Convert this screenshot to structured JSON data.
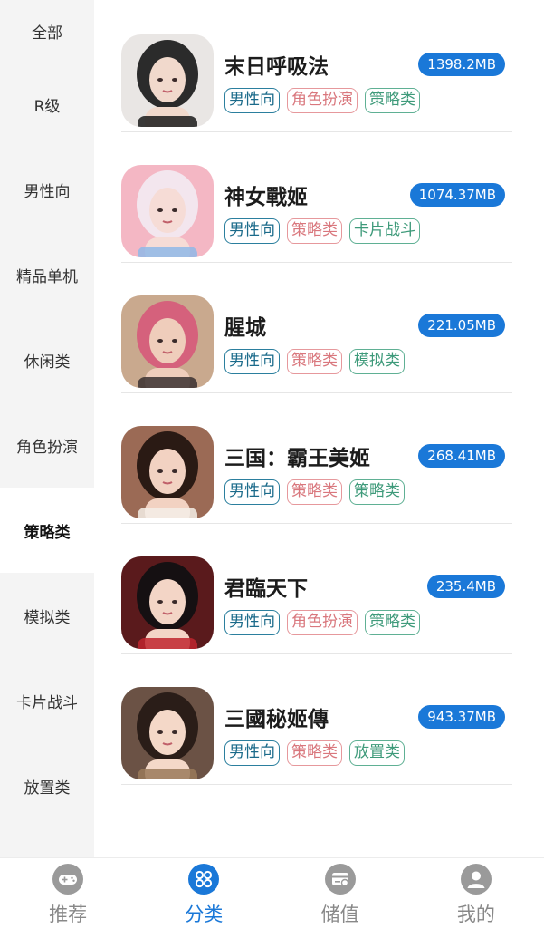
{
  "sidebar": {
    "active_index": 6,
    "items": [
      {
        "label": "全部"
      },
      {
        "label": "R级"
      },
      {
        "label": "男性向"
      },
      {
        "label": "精品单机"
      },
      {
        "label": "休闲类"
      },
      {
        "label": "角色扮演"
      },
      {
        "label": "策略类"
      },
      {
        "label": "模拟类"
      },
      {
        "label": "卡片战斗"
      },
      {
        "label": "放置类"
      }
    ]
  },
  "games": [
    {
      "title": "末日呼吸法",
      "size": "1398.2MB",
      "tags": [
        {
          "label": "男性向",
          "color": "blue"
        },
        {
          "label": "角色扮演",
          "color": "red"
        },
        {
          "label": "策略类",
          "color": "green"
        }
      ],
      "art": {
        "bg": "#e9e6e4",
        "hair": "#2b2b2b",
        "skin": "#f1d9cc",
        "accent": "#1a1a1a"
      }
    },
    {
      "title": "神女戰姬",
      "size": "1074.37MB",
      "tags": [
        {
          "label": "男性向",
          "color": "blue"
        },
        {
          "label": "策略类",
          "color": "red"
        },
        {
          "label": "卡片战斗",
          "color": "green"
        }
      ],
      "art": {
        "bg": "#f4b7c4",
        "hair": "#f3e6ee",
        "skin": "#f6dcd6",
        "accent": "#8fb8e8"
      }
    },
    {
      "title": "腥城",
      "size": "221.05MB",
      "tags": [
        {
          "label": "男性向",
          "color": "blue"
        },
        {
          "label": "策略类",
          "color": "red"
        },
        {
          "label": "模拟类",
          "color": "green"
        }
      ],
      "art": {
        "bg": "#c9a98e",
        "hair": "#d5617c",
        "skin": "#efcdbb",
        "accent": "#3a3030"
      }
    },
    {
      "title": "三国：霸王美姬",
      "size": "268.41MB",
      "tags": [
        {
          "label": "男性向",
          "color": "blue"
        },
        {
          "label": "策略类",
          "color": "red"
        },
        {
          "label": "策略类",
          "color": "green"
        }
      ],
      "art": {
        "bg": "#9b6a55",
        "hair": "#2a1a14",
        "skin": "#f2d2c2",
        "accent": "#f5efe8"
      }
    },
    {
      "title": "君臨天下",
      "size": "235.4MB",
      "tags": [
        {
          "label": "男性向",
          "color": "blue"
        },
        {
          "label": "角色扮演",
          "color": "red"
        },
        {
          "label": "策略类",
          "color": "green"
        }
      ],
      "art": {
        "bg": "#5a1a1c",
        "hair": "#151012",
        "skin": "#f3d5c6",
        "accent": "#c0262e"
      }
    },
    {
      "title": "三國秘姬傳",
      "size": "943.37MB",
      "tags": [
        {
          "label": "男性向",
          "color": "blue"
        },
        {
          "label": "策略类",
          "color": "red"
        },
        {
          "label": "放置类",
          "color": "green"
        }
      ],
      "art": {
        "bg": "#6b5245",
        "hair": "#2a1d18",
        "skin": "#f4d8c8",
        "accent": "#9a7a5a"
      }
    }
  ],
  "tabbar": {
    "active_index": 1,
    "tabs": [
      {
        "label": "推荐",
        "icon": "gamepad-icon"
      },
      {
        "label": "分类",
        "icon": "category-icon"
      },
      {
        "label": "储值",
        "icon": "wallet-icon"
      },
      {
        "label": "我的",
        "icon": "profile-icon"
      }
    ]
  },
  "colors": {
    "accent": "#1a78d8",
    "inactive_icon": "#9a9a9a"
  }
}
